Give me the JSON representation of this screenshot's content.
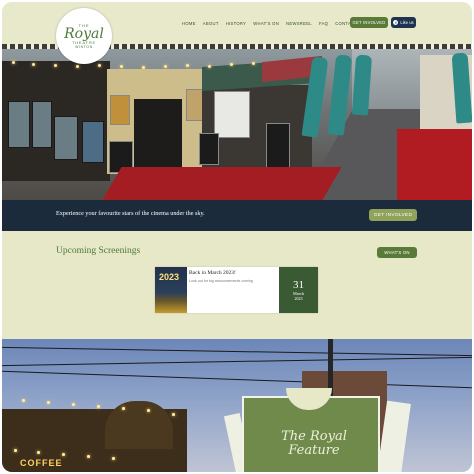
{
  "logo": {
    "the": "THE",
    "royal": "Royal",
    "theatre": "THEATRE",
    "town": "WINTON"
  },
  "nav": {
    "items": [
      "HOME",
      "ABOUT",
      "HISTORY",
      "WHAT'S ON",
      "NEWSREEL",
      "FAQ",
      "CONTACT"
    ]
  },
  "header": {
    "get_involved": "GET INVOLVED",
    "like_us": "Like us",
    "fb_glyph": "f"
  },
  "tagline": {
    "text": "Experience your favourite stars of the cinema under the sky.",
    "button": "GET INVOLVED"
  },
  "screenings": {
    "title": "Upcoming Screenings",
    "whats_on": "WHAT'S ON",
    "items": [
      {
        "thumb_text": "2023",
        "title": "Back in March 2023!",
        "subtitle": "Look out for big announcements coming",
        "day": "31",
        "month": "March",
        "year": "2023"
      }
    ]
  },
  "bottom": {
    "coffee_sign": "COFFEE",
    "feature_line1": "The Royal",
    "feature_line2": "Feature"
  },
  "colors": {
    "page_bg": "#e6e8c8",
    "accent_green": "#5a7a3a",
    "navy": "#1c2b3c",
    "date_green": "#3a5a33",
    "title_green": "#4f7a3a"
  }
}
